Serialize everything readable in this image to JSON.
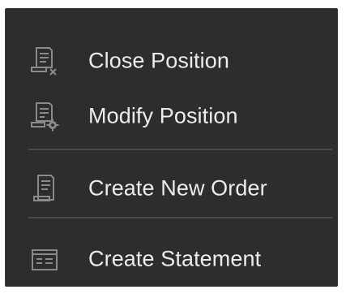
{
  "context_menu": {
    "items": [
      {
        "label": "Close Position",
        "icon": "close-position-icon"
      },
      {
        "label": "Modify Position",
        "icon": "modify-position-icon"
      },
      {
        "label": "Create New Order",
        "icon": "new-order-icon"
      },
      {
        "label": "Create Statement",
        "icon": "statement-icon"
      }
    ]
  },
  "colors": {
    "menu_background": "#2d2d2d",
    "text": "#ececec",
    "icon": "#8a8a8a",
    "separator": "#4a4a4a"
  }
}
